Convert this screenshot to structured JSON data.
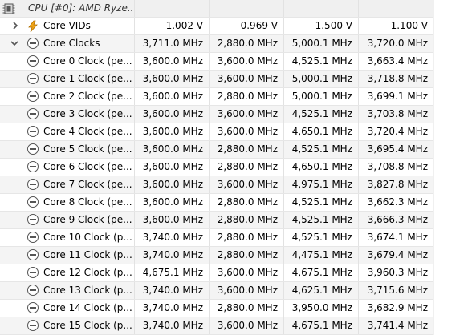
{
  "header": {
    "label": "CPU [#0]: AMD Ryze..."
  },
  "colors": {
    "row_alt": "#f4f4f4",
    "grid_line": "#e2e2e2",
    "volt_icon": "#f2a516",
    "chip_icon": "#555555"
  },
  "icons": {
    "header": "cpu-chip-icon",
    "vids": "voltage-icon",
    "clock": "clock-icon",
    "vids_expander": "chevron-right-icon",
    "clocks_expander": "chevron-down-icon"
  },
  "vids_row": {
    "label": "Core VIDs",
    "current": "1.002 V",
    "min": "0.969 V",
    "max": "1.500 V",
    "avg": "1.100 V"
  },
  "clocks_row": {
    "label": "Core Clocks",
    "current": "3,711.0 MHz",
    "min": "2,880.0 MHz",
    "max": "5,000.1 MHz",
    "avg": "3,720.0 MHz"
  },
  "cores": [
    {
      "label": "Core 0 Clock (pe...",
      "current": "3,600.0 MHz",
      "min": "3,600.0 MHz",
      "max": "4,525.1 MHz",
      "avg": "3,663.4 MHz"
    },
    {
      "label": "Core 1 Clock (pe...",
      "current": "3,600.0 MHz",
      "min": "3,600.0 MHz",
      "max": "5,000.1 MHz",
      "avg": "3,718.8 MHz"
    },
    {
      "label": "Core 2 Clock (pe...",
      "current": "3,600.0 MHz",
      "min": "2,880.0 MHz",
      "max": "5,000.1 MHz",
      "avg": "3,699.1 MHz"
    },
    {
      "label": "Core 3 Clock (pe...",
      "current": "3,600.0 MHz",
      "min": "3,600.0 MHz",
      "max": "4,525.1 MHz",
      "avg": "3,703.8 MHz"
    },
    {
      "label": "Core 4 Clock (pe...",
      "current": "3,600.0 MHz",
      "min": "3,600.0 MHz",
      "max": "4,650.1 MHz",
      "avg": "3,720.4 MHz"
    },
    {
      "label": "Core 5 Clock (pe...",
      "current": "3,600.0 MHz",
      "min": "2,880.0 MHz",
      "max": "4,525.1 MHz",
      "avg": "3,695.4 MHz"
    },
    {
      "label": "Core 6 Clock (pe...",
      "current": "3,600.0 MHz",
      "min": "2,880.0 MHz",
      "max": "4,650.1 MHz",
      "avg": "3,708.8 MHz"
    },
    {
      "label": "Core 7 Clock (pe...",
      "current": "3,600.0 MHz",
      "min": "3,600.0 MHz",
      "max": "4,975.1 MHz",
      "avg": "3,827.8 MHz"
    },
    {
      "label": "Core 8 Clock (pe...",
      "current": "3,600.0 MHz",
      "min": "2,880.0 MHz",
      "max": "4,525.1 MHz",
      "avg": "3,662.3 MHz"
    },
    {
      "label": "Core 9 Clock (pe...",
      "current": "3,600.0 MHz",
      "min": "2,880.0 MHz",
      "max": "4,525.1 MHz",
      "avg": "3,666.3 MHz"
    },
    {
      "label": "Core 10 Clock (p...",
      "current": "3,740.0 MHz",
      "min": "2,880.0 MHz",
      "max": "4,525.1 MHz",
      "avg": "3,674.1 MHz"
    },
    {
      "label": "Core 11 Clock (p...",
      "current": "3,740.0 MHz",
      "min": "2,880.0 MHz",
      "max": "4,475.1 MHz",
      "avg": "3,679.4 MHz"
    },
    {
      "label": "Core 12 Clock (p...",
      "current": "4,675.1 MHz",
      "min": "3,600.0 MHz",
      "max": "4,675.1 MHz",
      "avg": "3,960.3 MHz"
    },
    {
      "label": "Core 13 Clock (p...",
      "current": "3,740.0 MHz",
      "min": "3,600.0 MHz",
      "max": "4,625.1 MHz",
      "avg": "3,715.6 MHz"
    },
    {
      "label": "Core 14 Clock (p...",
      "current": "3,740.0 MHz",
      "min": "2,880.0 MHz",
      "max": "3,950.0 MHz",
      "avg": "3,682.9 MHz"
    },
    {
      "label": "Core 15 Clock (p...",
      "current": "3,740.0 MHz",
      "min": "3,600.0 MHz",
      "max": "4,675.1 MHz",
      "avg": "3,741.4 MHz"
    }
  ]
}
